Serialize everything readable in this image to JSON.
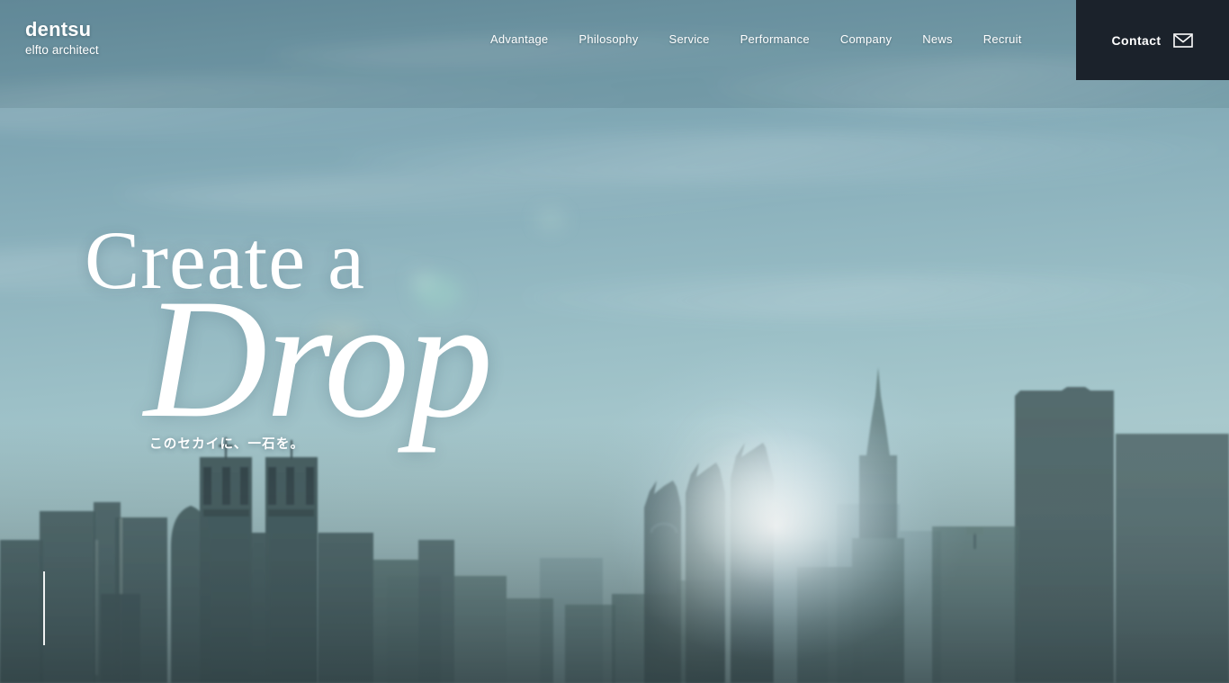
{
  "site": {
    "logo_main": "dentsu",
    "logo_sub": "elfto architect"
  },
  "header": {
    "nav_items": [
      {
        "label": "Advantage"
      },
      {
        "label": "Philosophy"
      },
      {
        "label": "Service"
      },
      {
        "label": "Performance"
      },
      {
        "label": "Company"
      },
      {
        "label": "News"
      },
      {
        "label": "Recruit"
      }
    ],
    "contact": {
      "label": "Contact",
      "icon": "mail-envelope-icon",
      "background_color": "#1b222b",
      "text_color": "#ffffff"
    }
  },
  "hero": {
    "headline_line1": "Create a",
    "headline_line2": "Drop",
    "tagline": "このセカイに、一石を。",
    "text_color": "#ffffff",
    "background": {
      "description": "hazy sunlit Tokyo city skyline at dawn under a pale blue sky",
      "sky_top_color": "#6b93a3",
      "sky_mid_color": "#8db3bf",
      "haze_glow_color": "#cfe3ec",
      "skyline_color": "#3c4f52",
      "ground_color": "#36464a"
    },
    "scroll_indicator": {
      "name": "vertical-scroll-line",
      "color": "#ffffff"
    }
  }
}
